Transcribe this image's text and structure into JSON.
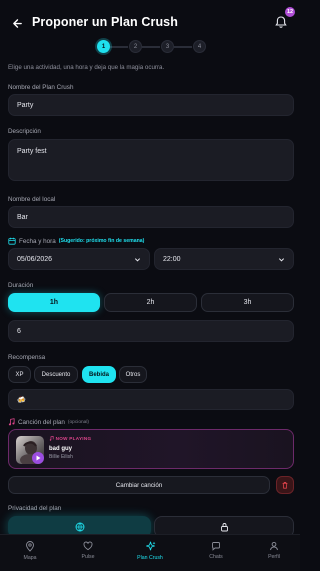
{
  "header": {
    "title": "Proponer un Plan Crush",
    "notification_count": "12"
  },
  "stepper": {
    "steps": [
      "1",
      "2",
      "3",
      "4"
    ],
    "active": 1
  },
  "intro_text": "Elige una actividad, una hora y deja que la magia ocurra.",
  "form": {
    "plan_name_label": "Nombre del Plan Crush",
    "plan_name_value": "Party",
    "description_label": "Descripción",
    "description_value": "Party fest",
    "venue_label": "Nombre del local",
    "venue_value": "Bar",
    "date_label": "Fecha y hora",
    "date_hint": "(Sugerido: próximo fin de semana)",
    "date_value": "05/06/2026",
    "time_value": "22:00",
    "duration_label": "Duración",
    "duration_options": [
      "1h",
      "2h",
      "3h"
    ],
    "duration_selected": "1h",
    "custom_value": "6",
    "reward_label": "Recompensa",
    "reward_options": [
      "XP",
      "Descuento",
      "Bebida",
      "Otros"
    ],
    "reward_selected": "Bebida",
    "reward_emoji": "🍻",
    "song_label": "Canción del plan",
    "song_optional": "(opcional)",
    "privacy_label": "Privacidad del plan"
  },
  "song": {
    "now_playing": "NOW PLAYING",
    "title": "bad guy",
    "artist": "Billie Eilish",
    "change_label": "Cambiar canción"
  },
  "tabbar": {
    "items": [
      "Mapa",
      "Pulse",
      "Plan Crush",
      "Chats",
      "Perfil"
    ],
    "active": "Plan Crush"
  },
  "colors": {
    "accent": "#1fe0ee",
    "background": "#0b0c12",
    "song_accent": "#e0468d",
    "danger": "#e0434b"
  }
}
